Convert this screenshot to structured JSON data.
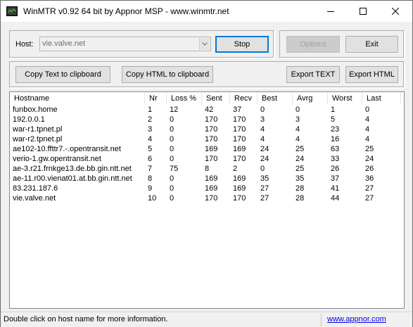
{
  "window": {
    "title": "WinMTR v0.92 64 bit by Appnor MSP - www.winmtr.net"
  },
  "host": {
    "label": "Host:",
    "value": "vie.valve.net"
  },
  "buttons": {
    "stop": "Stop",
    "options": "Options",
    "exit": "Exit",
    "copy_text": "Copy Text to clipboard",
    "copy_html": "Copy HTML to clipboard",
    "export_text": "Export TEXT",
    "export_html": "Export HTML"
  },
  "table": {
    "columns": [
      "Hostname",
      "Nr",
      "Loss %",
      "Sent",
      "Recv",
      "Best",
      "Avrg",
      "Worst",
      "Last"
    ],
    "rows": [
      [
        "funbox.home",
        "1",
        "12",
        "42",
        "37",
        "0",
        "0",
        "1",
        "0"
      ],
      [
        "192.0.0.1",
        "2",
        "0",
        "170",
        "170",
        "3",
        "3",
        "5",
        "4"
      ],
      [
        "war-r1.tpnet.pl",
        "3",
        "0",
        "170",
        "170",
        "4",
        "4",
        "23",
        "4"
      ],
      [
        "war-r2.tpnet.pl",
        "4",
        "0",
        "170",
        "170",
        "4",
        "4",
        "16",
        "4"
      ],
      [
        "ae102-10.ffttr7.-.opentransit.net",
        "5",
        "0",
        "169",
        "169",
        "24",
        "25",
        "63",
        "25"
      ],
      [
        "verio-1.gw.opentransit.net",
        "6",
        "0",
        "170",
        "170",
        "24",
        "24",
        "33",
        "24"
      ],
      [
        "ae-3.r21.frnkge13.de.bb.gin.ntt.net",
        "7",
        "75",
        "8",
        "2",
        "0",
        "25",
        "26",
        "26"
      ],
      [
        "ae-11.r00.vienat01.at.bb.gin.ntt.net",
        "8",
        "0",
        "169",
        "169",
        "35",
        "35",
        "37",
        "36"
      ],
      [
        "83.231.187.6",
        "9",
        "0",
        "169",
        "169",
        "27",
        "28",
        "41",
        "27"
      ],
      [
        "vie.valve.net",
        "10",
        "0",
        "170",
        "170",
        "27",
        "28",
        "44",
        "27"
      ]
    ]
  },
  "status": {
    "message": "Double click on host name for more information.",
    "link": "www.appnor.com"
  },
  "icons": {
    "app": "winmtr-app-icon",
    "minimize": "minimize-icon",
    "maximize": "maximize-icon",
    "close": "close-icon",
    "dropdown": "chevron-down-icon"
  },
  "colors": {
    "default_button_border": "#0078d7",
    "link": "#0000ee",
    "disabled_text": "#a0a0a0"
  }
}
